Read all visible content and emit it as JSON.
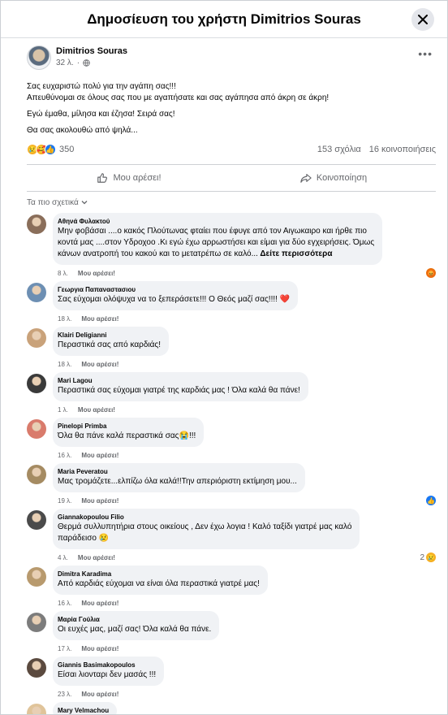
{
  "modal": {
    "title": "Δημοσίευση του χρήστη Dimitrios Souras",
    "close_icon": "close-icon"
  },
  "post": {
    "author": "Dimitrios Souras",
    "time": "32 λ.",
    "audience_icon": "globe-icon",
    "more_icon": "more-horizontal-icon",
    "paragraphs": [
      "Σας ευχαριστώ πολύ για την αγάπη σας!!!",
      "Απευθύνομαι σε όλους σας που με αγαπήσατε και σας αγάπησα από άκρη σε άκρη!",
      "Εγώ έμαθα, μίλησα και έζησα! Σειρά σας!",
      "Θα σας ακολουθώ από ψηλά..."
    ],
    "reaction_count": "350",
    "comments_count": "153 σχόλια",
    "shares_count": "16 κοινοποιήσεις",
    "like_label": "Μου αρέσει!",
    "share_label": "Κοινοποίηση",
    "sort_label": "Τα πιο σχετικά"
  },
  "comments": [
    {
      "author": "Αθηνά Φυλακτού",
      "lines": [
        "Μην φοβάσαι ....ο κακός Πλούτωνας φταίει που έφυγε από τον Αιγωκαιρο και ήρθε πιο",
        "κοντά μας ....στον Υδροχοο .Κι εγώ έχω αρρωστήσει και είμαι για δύο εγχειρήσεις. Όμως",
        "κάνων ανατροπή του κακού και το μετατρέπω σε καλό..."
      ],
      "see_more": "Δείτε περισσότερα",
      "time": "8 λ.",
      "like": "Μου αρέσει!",
      "reaction": "angry",
      "reaction_count": "",
      "avatar_color": "#8a6e5a"
    },
    {
      "author": "Γεωργια Παπαναστασιου",
      "lines": [
        "Σας εύχομαι ολόψυχα να το ξεπεράσετε!!! Ο Θεός μαζί σας!!!! ❤️"
      ],
      "time": "18 λ.",
      "like": "Μου αρέσει!",
      "avatar_color": "#6d8fb3"
    },
    {
      "author": "Klairi Deligianni",
      "lines": [
        "Περαστικά σας από καρδιάς!"
      ],
      "time": "18 λ.",
      "like": "Μου αρέσει!",
      "avatar_color": "#c9a27a"
    },
    {
      "author": "Mari Lagou",
      "lines": [
        "Περαστικά σας εύχομαι γιατρέ της καρδιάς μας ! Όλα καλά θα πάνε!"
      ],
      "time": "1 λ.",
      "like": "Μου αρέσει!",
      "avatar_color": "#3a3a3a"
    },
    {
      "author": "Pinelopi Primba",
      "lines": [
        "Όλα θα πάνε καλά περαστικά σας😭!!!"
      ],
      "time": "16 λ.",
      "like": "Μου αρέσει!",
      "avatar_color": "#d97b6c"
    },
    {
      "author": "Maria Peveratou",
      "lines": [
        "Μας τρομάζετε...ελπίζω όλα καλά!!Την απεριόριστη εκτίμηση μου..."
      ],
      "time": "19 λ.",
      "like": "Μου αρέσει!",
      "reaction": "like",
      "reaction_count": "",
      "avatar_color": "#a58b62"
    },
    {
      "author": "Giannakopoulou Filio",
      "lines": [
        "Θερμά συλλυπητήρια στους οικείους , Δεν έχω λογια ! Καλό ταξίδι γιατρέ μας καλό",
        "παράδεισο 😢"
      ],
      "time": "4 λ.",
      "like": "Μου αρέσει!",
      "reaction": "sad",
      "reaction_count": "2",
      "avatar_color": "#4b4b4b"
    },
    {
      "author": "Dimitra Karadima",
      "lines": [
        "Από καρδιάς εύχομαι να είναι όλα περαστικά γιατρέ μας!"
      ],
      "time": "16 λ.",
      "like": "Μου αρέσει!",
      "avatar_color": "#b89a6e"
    },
    {
      "author": "Μαρία Γούλια",
      "lines": [
        "Οι ευχές μας, μαζί σας! Όλα καλά θα πάνε."
      ],
      "time": "17 λ.",
      "like": "Μου αρέσει!",
      "avatar_color": "#7c7c7c"
    },
    {
      "author": "Giannis Basimakopoulos",
      "lines": [
        "Είσαι λιονταρι δεν μασάς !!!"
      ],
      "time": "23 λ.",
      "like": "Μου αρέσει!",
      "avatar_color": "#5b4a3f"
    },
    {
      "author": "Mary Velmachou",
      "lines": [
        ""
      ],
      "time": "",
      "like": "",
      "avatar_color": "#e0c49a"
    }
  ]
}
